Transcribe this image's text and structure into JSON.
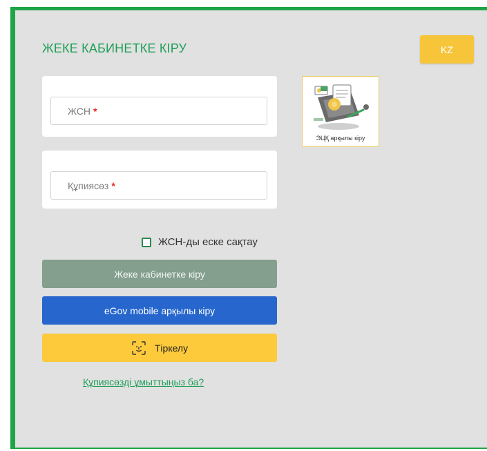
{
  "header": {
    "title": "ЖЕКЕ КАБИНЕТКЕ КІРУ",
    "lang_button": "KZ"
  },
  "form": {
    "iin_placeholder": "ЖСН",
    "password_placeholder": "Құпиясөз",
    "required_mark": "*",
    "remember_label": "ЖСН-ды еске сақтау",
    "remember_checked": false
  },
  "ecp": {
    "label": "ЭЦҚ арқылы кіру",
    "icon": "digital-signature-icon"
  },
  "buttons": {
    "login": "Жеке кабинетке кіру",
    "egov": "eGov mobile арқылы кіру",
    "register": "Тіркелу"
  },
  "links": {
    "forgot": "Құпиясөзді ұмыттыңыз ба?"
  },
  "colors": {
    "brand_green": "#1fa547",
    "accent_yellow": "#f7c53a",
    "egov_blue": "#2666cd",
    "login_gray_green": "#849f8d"
  }
}
